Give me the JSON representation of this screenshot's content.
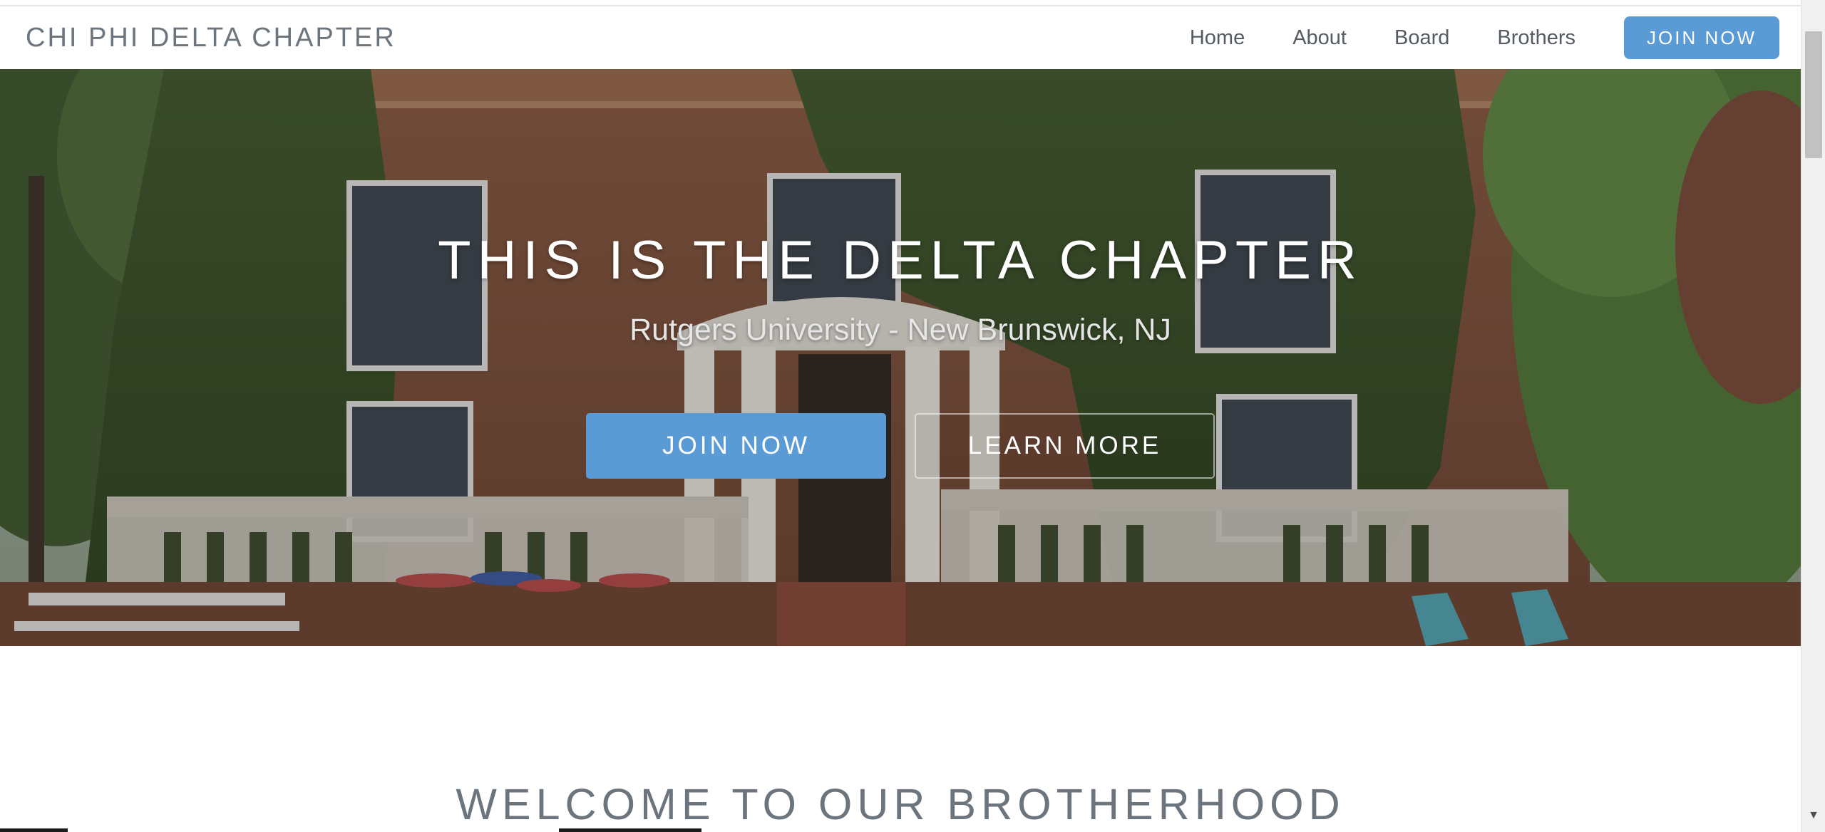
{
  "navbar": {
    "brand": "CHI PHI DELTA CHAPTER",
    "links": [
      "Home",
      "About",
      "Board",
      "Brothers"
    ],
    "join_label": "JOIN NOW"
  },
  "hero": {
    "title": "THIS IS THE DELTA CHAPTER",
    "subtitle": "Rutgers University - New Brunswick, NJ",
    "join_label": "JOIN NOW",
    "learn_label": "LEARN MORE"
  },
  "welcome": {
    "title": "WELCOME TO OUR BROTHERHOOD"
  },
  "colors": {
    "accent": "#5b9bd5",
    "brand_text": "#6c757d"
  }
}
